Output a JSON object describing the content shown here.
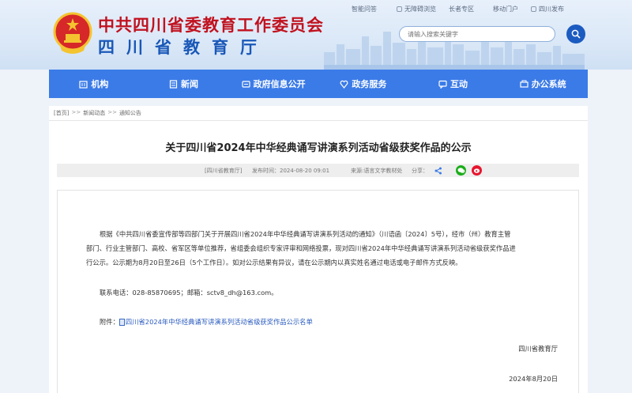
{
  "header": {
    "org_title": "中共四川省委教育工作委员会",
    "dept_title": "四川省教育厅",
    "top_links": [
      "智能问答",
      "无障碍浏览",
      "长者专区",
      "移动门户",
      "四川发布"
    ],
    "search_placeholder": "请输入搜索关键字"
  },
  "nav": {
    "items": [
      {
        "label": "机构",
        "icon": "building-icon"
      },
      {
        "label": "新闻",
        "icon": "news-icon"
      },
      {
        "label": "政府信息公开",
        "icon": "open-info-icon"
      },
      {
        "label": "政务服务",
        "icon": "service-icon"
      },
      {
        "label": "互动",
        "icon": "chat-icon"
      },
      {
        "label": "办公系统",
        "icon": "office-icon"
      }
    ]
  },
  "breadcrumb": {
    "home": "[首页]",
    "sep": ">>",
    "level1": "新闻动态",
    "level2": "通知公告"
  },
  "article": {
    "title": "关于四川省2024年中华经典诵写讲演系列活动省级获奖作品的公示",
    "source_tag": "[四川省教育厅]",
    "publish_time": "发布时间：2024-08-20 09:01",
    "origin": "来源:语言文字教材处",
    "share_label": "分享：",
    "body_lines": [
      "根据《中共四川省委宣传部等四部门关于开展四川省2024年中华经典诵写讲演系列活动的通知》（川语函〔2024〕5号），经市（州）教育主管",
      "部门、行业主管部门、高校、省军区等单位推荐，省组委会组织专家评审和网络投票，现对四川省2024年中华经典诵写讲演系列活动省级获奖作品进",
      "行公示。公示期为8月20日至26日（5个工作日）。如对公示结果有异议，请在公示期内以真实姓名通过电话或电子邮件方式反映。"
    ],
    "contact": "联系电话：028-85870695；邮箱：sctv8_dh@163.com。",
    "attachment_label": "附件：",
    "attachment_name": "四川省2024年中华经典诵写讲演系列活动省级获奖作品公示名单",
    "signature": "四川省教育厅",
    "date": "2024年8月20日"
  },
  "colors": {
    "nav_bg": "#3b7be8",
    "title_red": "#c1121f",
    "title_blue": "#1a58b8",
    "wechat": "#1aad19",
    "weibo": "#e6162d"
  }
}
